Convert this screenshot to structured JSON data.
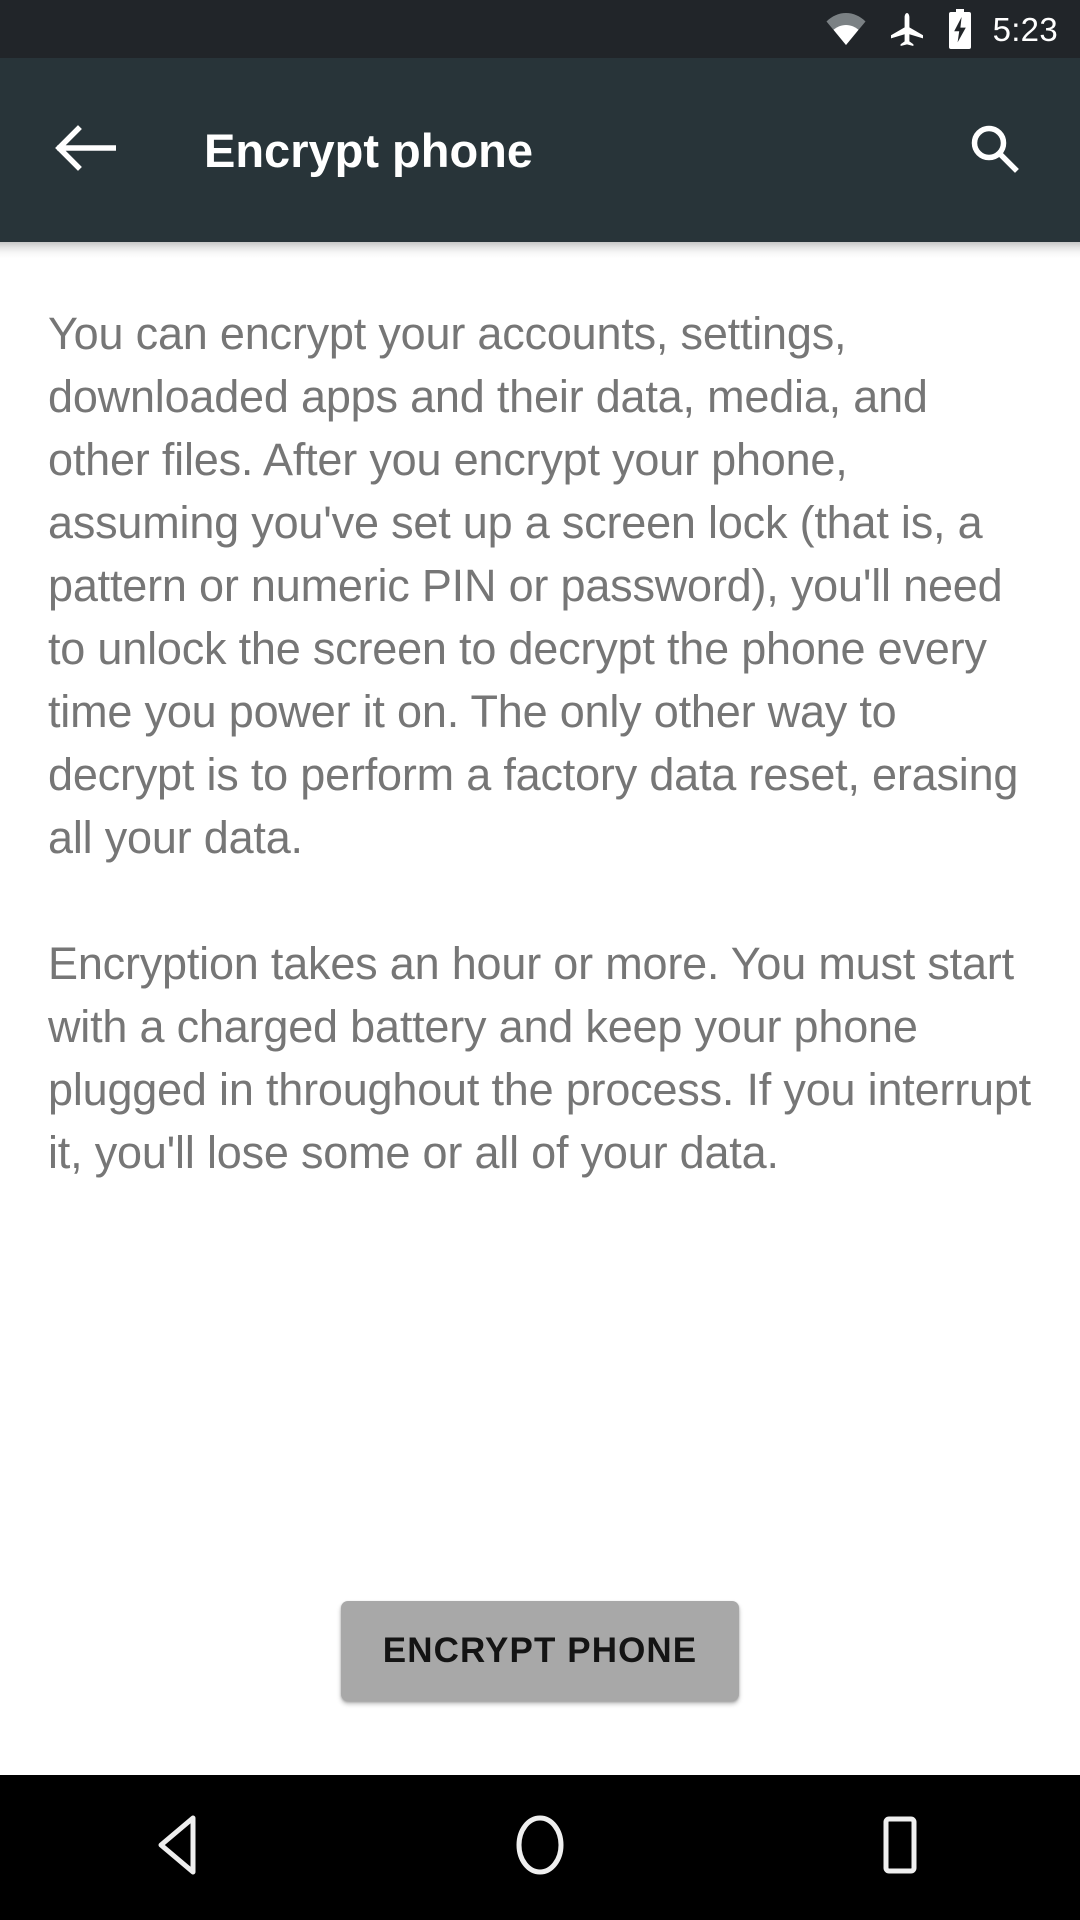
{
  "status_bar": {
    "time": "5:23",
    "icons": [
      {
        "name": "wifi-icon",
        "label": "Wi-Fi"
      },
      {
        "name": "airplane-mode-icon",
        "label": "Airplane mode"
      },
      {
        "name": "battery-charging-icon",
        "label": "Battery charging"
      }
    ],
    "background_color": "#212529",
    "foreground_color": "#ffffff"
  },
  "action_bar": {
    "title": "Encrypt phone",
    "back_icon": "arrow-back-icon",
    "search_icon": "search-icon",
    "background_color": "#283439",
    "title_color": "#ffffff"
  },
  "content": {
    "paragraph_1": "You can encrypt your accounts, settings, downloaded apps and their data, media, and other files. After you encrypt your phone, assuming you've set up a screen lock (that is, a pattern or numeric PIN or password), you'll need to unlock the screen to decrypt the phone every time you power it on. The only other way to decrypt is to perform a factory data reset, erasing all your data.",
    "paragraph_2": "Encryption takes an hour or more. You must start with a charged battery and keep your phone plugged in throughout the process. If you interrupt it, you'll lose some or all of your data.",
    "text_color": "#767676",
    "background_color": "#ffffff"
  },
  "button": {
    "label": "ENCRYPT PHONE",
    "background_color": "#a8a8a8",
    "text_color": "#141414"
  },
  "nav_bar": {
    "background_color": "#000000",
    "items": [
      {
        "name": "nav-back-icon",
        "label": "Back"
      },
      {
        "name": "nav-home-icon",
        "label": "Home"
      },
      {
        "name": "nav-recents-icon",
        "label": "Recent apps"
      }
    ]
  }
}
